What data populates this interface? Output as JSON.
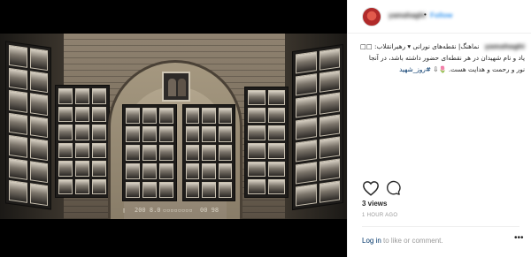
{
  "post": {
    "username": "yamahaghi",
    "separator": "•",
    "follow_label": "Follow",
    "caption_username": "yamahaghi",
    "caption_lines": [
      "نماهنگ| نقطه‌های نورانی ▾ رهبرانقلاب: □□",
      "یاد و نام شهیدان در هر نقطه‌ای حضور داشته باشد، در آنجا",
      "نور و رحمت و هدایت هست. 🌷⇩"
    ],
    "hashtag": "#روز_شهید",
    "views": "3 views",
    "time": "1 HOUR AGO",
    "login_link": "Log in",
    "login_text": " to like or comment.",
    "more": "•••"
  },
  "video_hud": {
    "left": "▯",
    "mid_a": "200  8.0",
    "mid_b": "▫▫▫▫▫▫▫▫",
    "right": "00  98"
  },
  "icons": {
    "heart": "heart-icon",
    "comment": "comment-icon",
    "avatar": "avatar-image"
  },
  "colors": {
    "link": "#003569",
    "follow": "#3897f0",
    "muted": "#999999"
  }
}
